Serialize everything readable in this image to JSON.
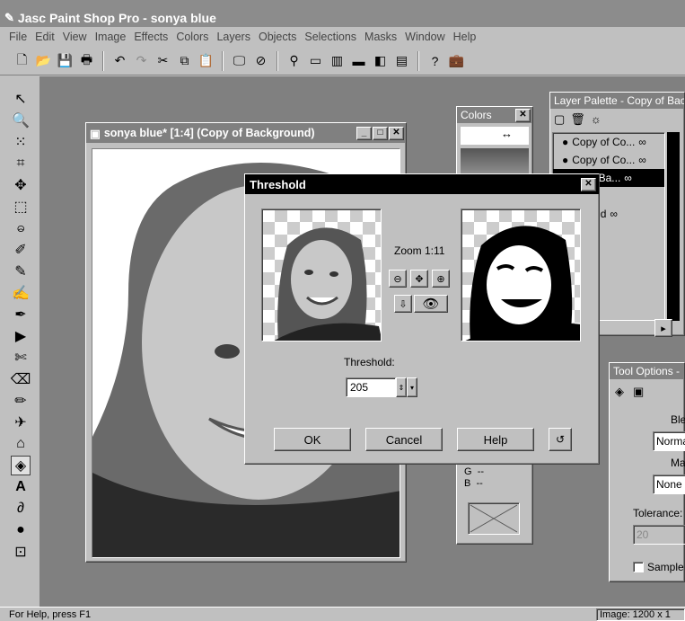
{
  "app": {
    "title": "Jasc Paint Shop Pro - sonya blue"
  },
  "menu": [
    "File",
    "Edit",
    "View",
    "Image",
    "Effects",
    "Colors",
    "Layers",
    "Objects",
    "Selections",
    "Masks",
    "Window",
    "Help"
  ],
  "image_window": {
    "title": "sonya blue* [1:4] (Copy of Background)"
  },
  "colors_palette": {
    "title": "Colors",
    "close": "✕",
    "g_label": "G",
    "g_value": "--",
    "b_label": "B",
    "b_value": "--"
  },
  "layer_palette": {
    "title": "Layer Palette - Copy of Bac",
    "layers": [
      {
        "name": "Copy of Co..."
      },
      {
        "name": "Copy of Co..."
      },
      {
        "name": "py of Ba..."
      },
      {
        "name": "te"
      },
      {
        "name": "ckground"
      }
    ]
  },
  "tool_options": {
    "title": "Tool Options -",
    "blend_label": "Ble",
    "blend_value": "Norma",
    "mask_label": "Ma",
    "mask_value": "None",
    "tolerance_label": "Tolerance:",
    "tolerance_value": "20",
    "sample_label": "Sample"
  },
  "threshold": {
    "title": "Threshold",
    "zoom_label": "Zoom 1:11",
    "threshold_label": "Threshold:",
    "threshold_value": "205",
    "ok_label": "OK",
    "cancel_label": "Cancel",
    "help_label": "Help"
  },
  "status": {
    "left": "For Help, press F1",
    "right": "Image: 1200 x 1"
  }
}
